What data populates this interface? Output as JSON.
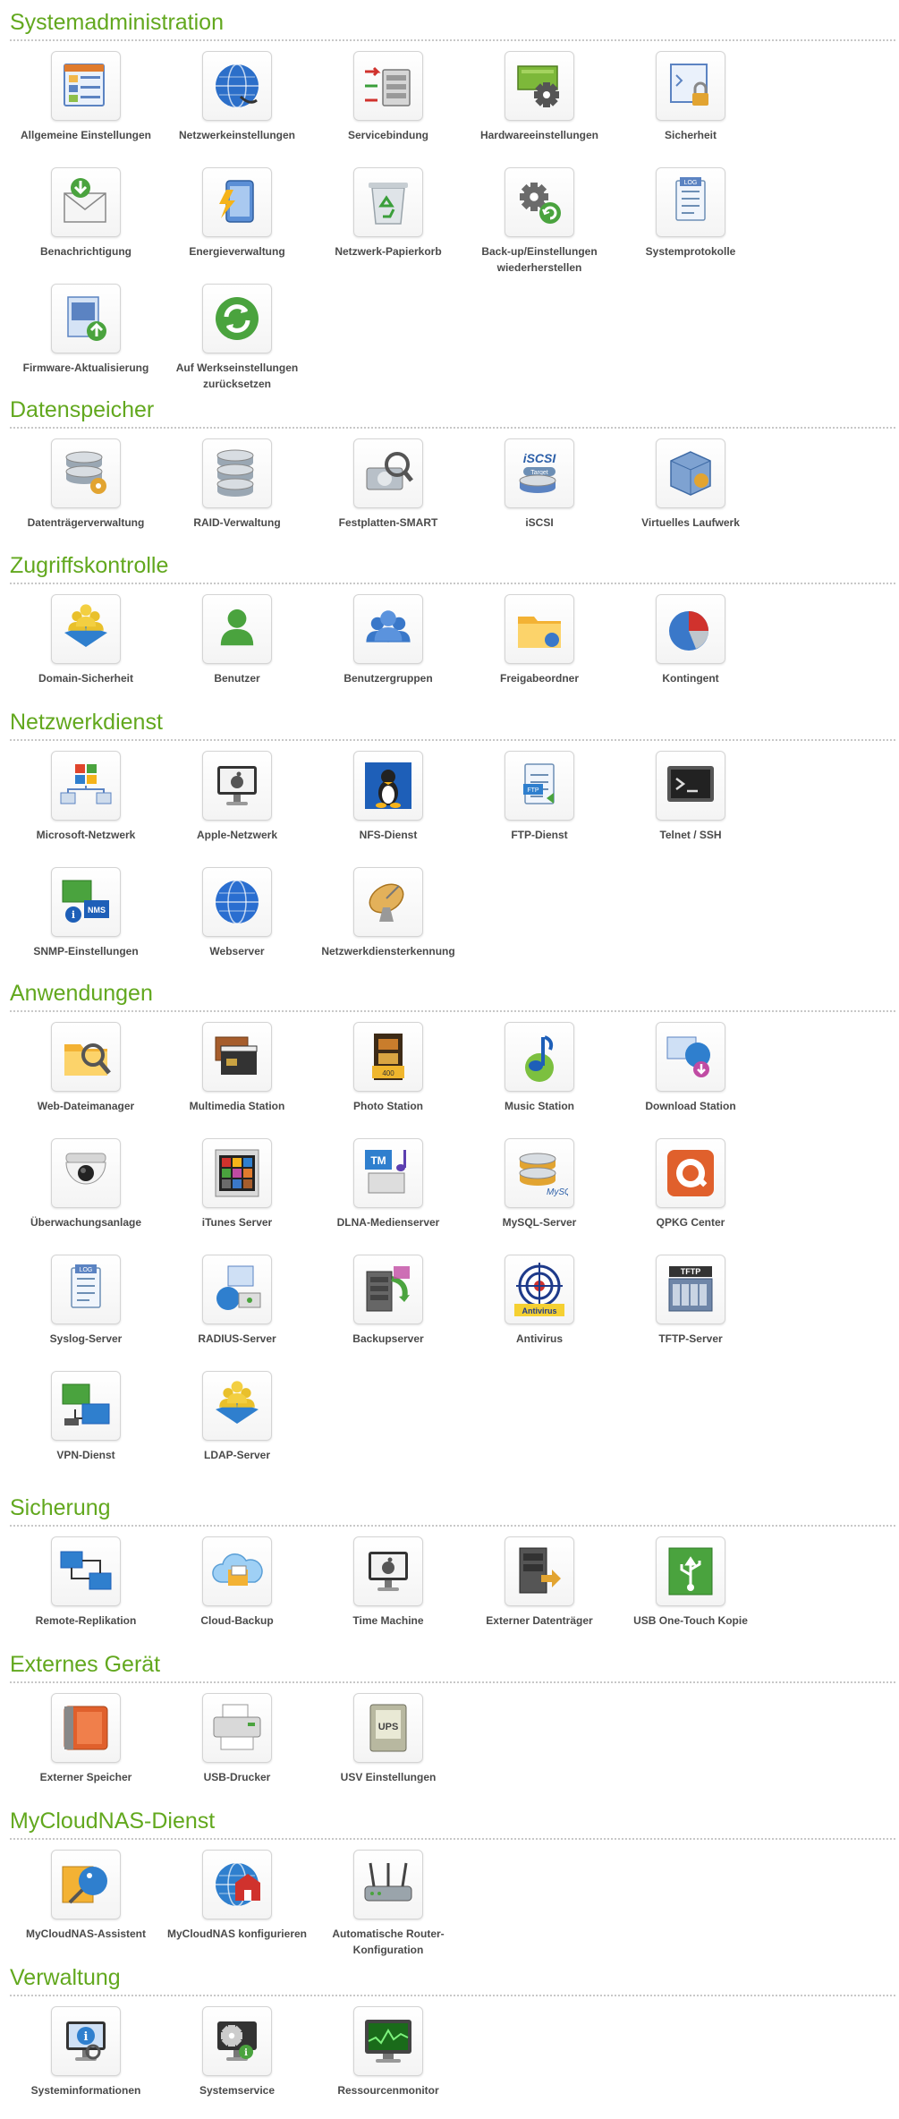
{
  "sections": [
    {
      "title": "Systemadministration",
      "items": [
        {
          "label": "Allgemeine Einstellungen",
          "icon": "general-settings-icon"
        },
        {
          "label": "Netzwerkeinstellungen",
          "icon": "network-globe-icon"
        },
        {
          "label": "Servicebindung",
          "icon": "service-binding-icon"
        },
        {
          "label": "Hardwareeinstellungen",
          "icon": "hardware-gear-icon"
        },
        {
          "label": "Sicherheit",
          "icon": "security-lock-icon"
        },
        {
          "label": "Benachrichtigung",
          "icon": "notification-envelope-icon"
        },
        {
          "label": "Energieverwaltung",
          "icon": "power-lightning-icon"
        },
        {
          "label": "Netzwerk-Papierkorb",
          "icon": "recycle-bin-icon"
        },
        {
          "label": "Back-up/Einstellungen\nwiederherstellen",
          "icon": "backup-restore-gear-icon"
        },
        {
          "label": "Systemprotokolle",
          "icon": "system-log-icon"
        },
        {
          "label": "Firmware-Aktualisierung",
          "icon": "firmware-update-icon"
        },
        {
          "label": "Auf Werkseinstellungen\nzurücksetzen",
          "icon": "factory-reset-icon"
        }
      ]
    },
    {
      "title": "Datenspeicher",
      "items": [
        {
          "label": "Datenträgerverwaltung",
          "icon": "disk-management-icon"
        },
        {
          "label": "RAID-Verwaltung",
          "icon": "raid-icon"
        },
        {
          "label": "Festplatten-SMART",
          "icon": "hdd-smart-icon"
        },
        {
          "label": "iSCSI",
          "icon": "iscsi-target-icon"
        },
        {
          "label": "Virtuelles Laufwerk",
          "icon": "virtual-disk-icon"
        }
      ]
    },
    {
      "title": "Zugriffskontrolle",
      "items": [
        {
          "label": "Domain-Sicherheit",
          "icon": "domain-security-icon"
        },
        {
          "label": "Benutzer",
          "icon": "user-icon"
        },
        {
          "label": "Benutzergruppen",
          "icon": "user-group-icon"
        },
        {
          "label": "Freigabeordner",
          "icon": "shared-folder-icon"
        },
        {
          "label": "Kontingent",
          "icon": "quota-pie-icon"
        }
      ]
    },
    {
      "title": "Netzwerkdienst",
      "items": [
        {
          "label": "Microsoft-Netzwerk",
          "icon": "windows-network-icon"
        },
        {
          "label": "Apple-Netzwerk",
          "icon": "apple-network-icon"
        },
        {
          "label": "NFS-Dienst",
          "icon": "nfs-linux-icon"
        },
        {
          "label": "FTP-Dienst",
          "icon": "ftp-icon"
        },
        {
          "label": "Telnet / SSH",
          "icon": "terminal-icon"
        },
        {
          "label": "SNMP-Einstellungen",
          "icon": "snmp-nms-icon"
        },
        {
          "label": "Webserver",
          "icon": "webserver-globe-icon"
        },
        {
          "label": "Netzwerkdiensterkennung",
          "icon": "satellite-dish-icon"
        }
      ]
    },
    {
      "title": "Anwendungen",
      "items": [
        {
          "label": "Web-Dateimanager",
          "icon": "web-file-manager-icon"
        },
        {
          "label": "Multimedia Station",
          "icon": "multimedia-clapper-icon"
        },
        {
          "label": "Photo Station",
          "icon": "photo-film-icon"
        },
        {
          "label": "Music Station",
          "icon": "music-note-icon"
        },
        {
          "label": "Download Station",
          "icon": "download-globe-icon"
        },
        {
          "label": "Überwachungsanlage",
          "icon": "surveillance-camera-icon"
        },
        {
          "label": "iTunes Server",
          "icon": "itunes-server-icon"
        },
        {
          "label": "DLNA-Medienserver",
          "icon": "dlna-media-icon"
        },
        {
          "label": "MySQL-Server",
          "icon": "mysql-database-icon"
        },
        {
          "label": "QPKG Center",
          "icon": "qpkg-center-icon"
        },
        {
          "label": "Syslog-Server",
          "icon": "syslog-icon"
        },
        {
          "label": "RADIUS-Server",
          "icon": "radius-server-icon"
        },
        {
          "label": "Backupserver",
          "icon": "backup-server-icon"
        },
        {
          "label": "Antivirus",
          "icon": "antivirus-target-icon",
          "badge": "Antivirus"
        },
        {
          "label": "TFTP-Server",
          "icon": "tftp-server-icon",
          "badge": "TFTP"
        },
        {
          "label": "VPN-Dienst",
          "icon": "vpn-icon"
        },
        {
          "label": "LDAP-Server",
          "icon": "ldap-server-icon"
        }
      ]
    },
    {
      "title": "Sicherung",
      "items": [
        {
          "label": "Remote-Replikation",
          "icon": "remote-replication-icon"
        },
        {
          "label": "Cloud-Backup",
          "icon": "cloud-backup-icon"
        },
        {
          "label": "Time Machine",
          "icon": "time-machine-icon"
        },
        {
          "label": "Externer Datenträger",
          "icon": "external-drive-icon"
        },
        {
          "label": "USB One-Touch Kopie",
          "icon": "usb-copy-icon"
        }
      ]
    },
    {
      "title": "Externes Gerät",
      "items": [
        {
          "label": "Externer Speicher",
          "icon": "external-storage-icon"
        },
        {
          "label": "USB-Drucker",
          "icon": "usb-printer-icon"
        },
        {
          "label": "USV Einstellungen",
          "icon": "ups-icon",
          "badge": "UPS"
        }
      ]
    },
    {
      "title": "MyCloudNAS-Dienst",
      "items": [
        {
          "label": "MyCloudNAS-Assistent",
          "icon": "mycloudnas-wizard-icon"
        },
        {
          "label": "MyCloudNAS konfigurieren",
          "icon": "mycloudnas-configure-icon"
        },
        {
          "label": "Automatische Router-\nKonfiguration",
          "icon": "router-icon"
        }
      ]
    },
    {
      "title": "Verwaltung",
      "items": [
        {
          "label": "Systeminformationen",
          "icon": "system-info-icon"
        },
        {
          "label": "Systemservice",
          "icon": "system-service-icon"
        },
        {
          "label": "Ressourcenmonitor",
          "icon": "resource-monitor-icon"
        }
      ]
    }
  ]
}
